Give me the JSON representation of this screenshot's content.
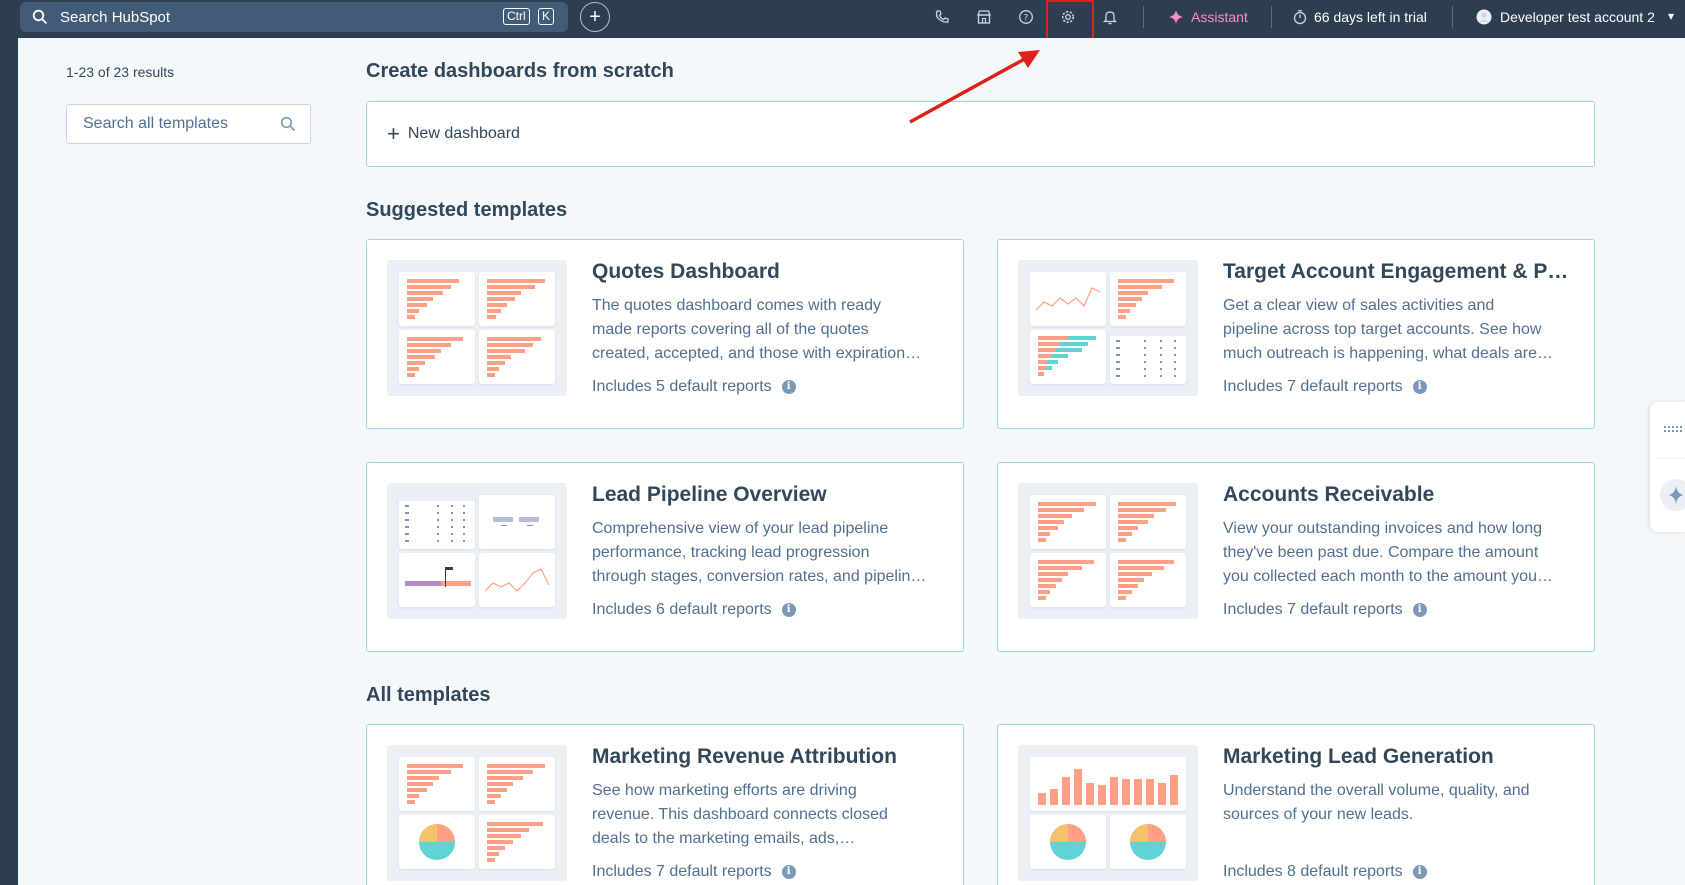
{
  "topbar": {
    "search_label": "Search HubSpot",
    "kbd_ctrl": "Ctrl",
    "kbd_k": "K",
    "assistant_label": "Assistant",
    "trial_label": "66 days left in trial",
    "account_label": "Developer test account 2",
    "icons": [
      "phone-icon",
      "marketplace-icon",
      "help-icon",
      "settings-icon",
      "notifications-icon"
    ]
  },
  "sidebar": {
    "results_label": "1-23 of 23 results",
    "search_placeholder": "Search all templates"
  },
  "sections": {
    "scratch_title": "Create dashboards from scratch",
    "new_dashboard_label": "New dashboard",
    "suggested_title": "Suggested templates",
    "all_title": "All templates"
  },
  "cards": [
    {
      "title": "Quotes Dashboard",
      "desc_lines": [
        "The quotes dashboard comes with ready",
        "made reports covering all of the quotes",
        "created, accepted, and those with expiration…"
      ],
      "includes": "Includes 5 default reports"
    },
    {
      "title": "Target Account Engagement & Pi…",
      "desc_lines": [
        "Get a clear view of sales activities and",
        "pipeline across top target accounts. See how",
        "much outreach is happening, what deals are…"
      ],
      "includes": "Includes 7 default reports"
    },
    {
      "title": "Lead Pipeline Overview",
      "desc_lines": [
        "Comprehensive view of your lead pipeline",
        "performance, tracking lead progression",
        "through stages, conversion rates, and pipelin…"
      ],
      "includes": "Includes 6 default reports"
    },
    {
      "title": "Accounts Receivable",
      "desc_lines": [
        "View your outstanding invoices and how long",
        "they've been past due. Compare the amount",
        "you collected each month to the amount you…"
      ],
      "includes": "Includes 7 default reports"
    },
    {
      "title": "Marketing Revenue Attribution",
      "desc_lines": [
        "See how marketing efforts are driving",
        "revenue. This dashboard connects closed",
        "deals to the marketing emails, ads,…"
      ],
      "includes": "Includes 7 default reports"
    },
    {
      "title": "Marketing Lead Generation",
      "desc_lines": [
        "Understand the overall volume, quality, and",
        "sources of your new leads.",
        ""
      ],
      "includes": "Includes 8 default reports"
    }
  ],
  "colors": {
    "nav_bg": "#2d3e50",
    "accent_orange": "#ff9f85",
    "accent_teal": "#5ed4d6",
    "annotation_red": "#e0201a"
  }
}
